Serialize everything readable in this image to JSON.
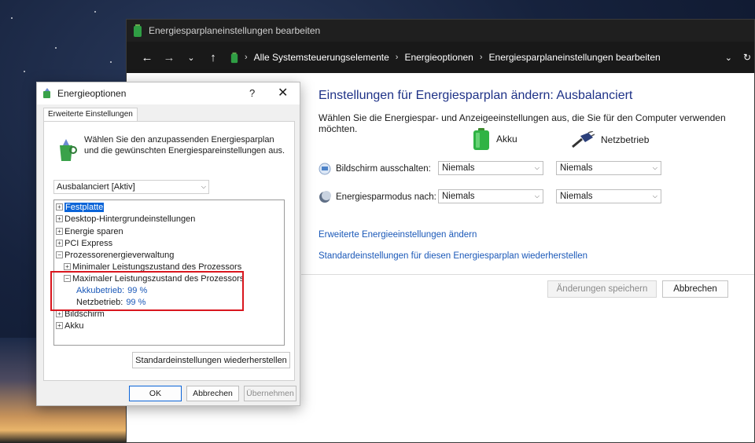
{
  "main_window": {
    "title": "Energiesparplaneinstellungen bearbeiten",
    "breadcrumbs": [
      "Alle Systemsteuerungselemente",
      "Energieoptionen",
      "Energiesparplaneinstellungen bearbeiten"
    ],
    "heading": "Einstellungen für Energiesparplan ändern: Ausbalanciert",
    "description": "Wählen Sie die Energiespar- und Anzeigeeinstellungen aus, die Sie für den Computer verwenden möchten.",
    "columns": {
      "battery": "Akku",
      "plugged": "Netzbetrieb"
    },
    "rows": [
      {
        "label": "Bildschirm ausschalten:",
        "battery": "Niemals",
        "plugged": "Niemals",
        "icon": "monitor-icon"
      },
      {
        "label": "Energiesparmodus nach:",
        "battery": "Niemals",
        "plugged": "Niemals",
        "icon": "moon-icon"
      }
    ],
    "links": {
      "advanced": "Erweiterte Energieeinstellungen ändern",
      "restore": "Standardeinstellungen für diesen Energiesparplan wiederherstellen"
    },
    "buttons": {
      "save": "Änderungen speichern",
      "cancel": "Abbrechen"
    }
  },
  "dialog": {
    "title": "Energieoptionen",
    "help": "?",
    "tab": "Erweiterte Einstellungen",
    "intro": "Wählen Sie den anzupassenden Energiesparplan und die gewünschten Energiespareinstellungen aus.",
    "plan": "Ausbalanciert [Aktiv]",
    "tree": [
      {
        "label": "Festplatte",
        "expander": "+",
        "selected": true
      },
      {
        "label": "Desktop-Hintergrundeinstellungen",
        "expander": "+"
      },
      {
        "label": "Energie sparen",
        "expander": "+"
      },
      {
        "label": "PCI Express",
        "expander": "+"
      },
      {
        "label": "Prozessorenergieverwaltung",
        "expander": "−"
      },
      {
        "label": "Minimaler Leistungszustand des Prozessors",
        "expander": "+"
      },
      {
        "label": "Maximaler Leistungszustand des Prozessors",
        "expander": "−"
      },
      {
        "label_prefix": "Akkubetrieb:",
        "value": "99 %"
      },
      {
        "label_prefix": "Netzbetrieb:",
        "value": "99 %"
      },
      {
        "label": "Bildschirm",
        "expander": "+"
      },
      {
        "label": "Akku",
        "expander": "+"
      }
    ],
    "restore_button": "Standardeinstellungen wiederherstellen",
    "buttons": {
      "ok": "OK",
      "cancel": "Abbrechen",
      "apply": "Übernehmen"
    }
  },
  "colors": {
    "highlight": "#d9161e",
    "selection": "#0a64d8",
    "link": "#1a58b8",
    "heading": "#1e3287"
  }
}
